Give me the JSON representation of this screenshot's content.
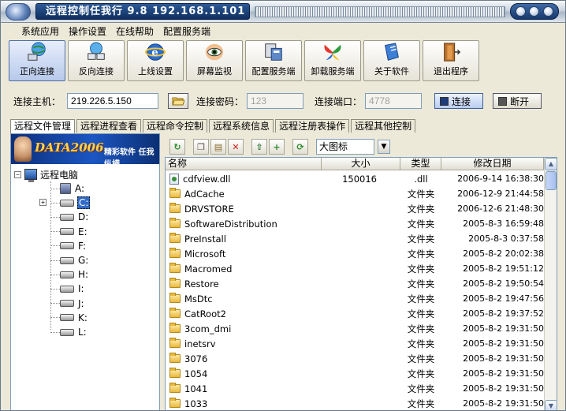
{
  "window": {
    "title": "远程控制任我行 9.8  192.168.1.101"
  },
  "menu": [
    "系统应用",
    "操作设置",
    "在线帮助",
    "配置服务端"
  ],
  "toolbar": [
    {
      "label": "正向连接",
      "icon": "globe-computer-icon",
      "active": true
    },
    {
      "label": "反向连接",
      "icon": "computer-network-icon"
    },
    {
      "label": "上线设置",
      "icon": "ie-globe-icon"
    },
    {
      "label": "屏幕监视",
      "icon": "eye-icon"
    },
    {
      "label": "配置服务端",
      "icon": "server-config-icon"
    },
    {
      "label": "卸载服务端",
      "icon": "butterfly-icon"
    },
    {
      "label": "关于软件",
      "icon": "book-icon"
    },
    {
      "label": "退出程序",
      "icon": "exit-door-icon"
    }
  ],
  "connection": {
    "host_label": "连接主机：",
    "host_value": "219.226.5.150",
    "password_label": "连接密码：",
    "password_value": "123",
    "port_label": "连接端口：",
    "port_value": "4778",
    "connect_label": "连接",
    "disconnect_label": "断开"
  },
  "tabs": [
    "远程文件管理",
    "远程进程查看",
    "远程命令控制",
    "远程系统信息",
    "远程注册表操作",
    "远程其他控制"
  ],
  "banner": {
    "brand": "DATA2006",
    "slogan": "精彩软件 任我纵横"
  },
  "tree": {
    "root": "远程电脑",
    "drives": [
      "A:",
      "C:",
      "D:",
      "E:",
      "F:",
      "G:",
      "H:",
      "I:",
      "J:",
      "K:",
      "L:"
    ],
    "selected": "C:"
  },
  "view_mode": "大图标",
  "columns": [
    "名称",
    "大小",
    "类型",
    "修改日期"
  ],
  "files": [
    {
      "name": "cdfview.dll",
      "size": "150016",
      "type": ".dll",
      "date": "2006-9-14 16:38:30",
      "kind": "file"
    },
    {
      "name": "AdCache",
      "size": "",
      "type": "文件夹",
      "date": "2006-12-9 21:44:58",
      "kind": "folder"
    },
    {
      "name": "DRVSTORE",
      "size": "",
      "type": "文件夹",
      "date": "2006-12-6 21:48:30",
      "kind": "folder"
    },
    {
      "name": "SoftwareDistribution",
      "size": "",
      "type": "文件夹",
      "date": "2005-8-3 16:59:48",
      "kind": "folder"
    },
    {
      "name": "PreInstall",
      "size": "",
      "type": "文件夹",
      "date": "2005-8-3 0:37:58",
      "kind": "folder"
    },
    {
      "name": "Microsoft",
      "size": "",
      "type": "文件夹",
      "date": "2005-8-2 20:02:38",
      "kind": "folder"
    },
    {
      "name": "Macromed",
      "size": "",
      "type": "文件夹",
      "date": "2005-8-2 19:51:12",
      "kind": "folder"
    },
    {
      "name": "Restore",
      "size": "",
      "type": "文件夹",
      "date": "2005-8-2 19:50:54",
      "kind": "folder"
    },
    {
      "name": "MsDtc",
      "size": "",
      "type": "文件夹",
      "date": "2005-8-2 19:47:56",
      "kind": "folder"
    },
    {
      "name": "CatRoot2",
      "size": "",
      "type": "文件夹",
      "date": "2005-8-2 19:37:52",
      "kind": "folder"
    },
    {
      "name": "3com_dmi",
      "size": "",
      "type": "文件夹",
      "date": "2005-8-2 19:31:50",
      "kind": "folder"
    },
    {
      "name": "inetsrv",
      "size": "",
      "type": "文件夹",
      "date": "2005-8-2 19:31:50",
      "kind": "folder"
    },
    {
      "name": "3076",
      "size": "",
      "type": "文件夹",
      "date": "2005-8-2 19:31:50",
      "kind": "folder"
    },
    {
      "name": "1054",
      "size": "",
      "type": "文件夹",
      "date": "2005-8-2 19:31:50",
      "kind": "folder"
    },
    {
      "name": "1041",
      "size": "",
      "type": "文件夹",
      "date": "2005-8-2 19:31:50",
      "kind": "folder"
    },
    {
      "name": "1033",
      "size": "",
      "type": "文件夹",
      "date": "2005-8-2 19:31:50",
      "kind": "folder"
    }
  ]
}
